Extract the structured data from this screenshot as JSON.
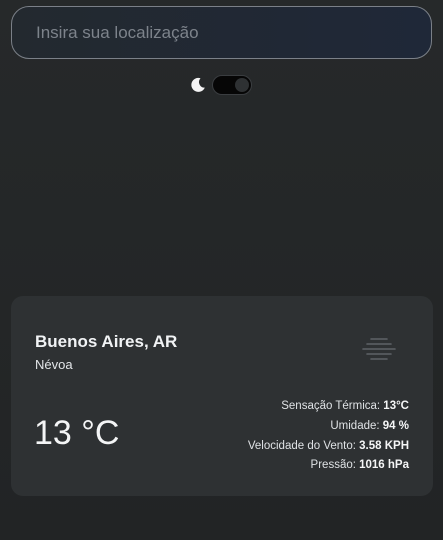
{
  "search": {
    "placeholder": "Insira sua localização",
    "value": ""
  },
  "theme": {
    "icon": "moon-icon",
    "toggle_state": "dark"
  },
  "weather": {
    "city": "Buenos Aires, AR",
    "condition": "Névoa",
    "icon": "fog-icon",
    "temperature": "13 °C",
    "feels_like_label": "Sensação Térmica:",
    "feels_like_value": "13°C",
    "humidity_label": "Umidade:",
    "humidity_value": "94 %",
    "wind_label": "Velocidade do Vento:",
    "wind_value": "3.58 KPH",
    "pressure_label": "Pressão:",
    "pressure_value": "1016 hPa"
  },
  "colors": {
    "background": "#242627",
    "card": "#2e3133",
    "search_border": "#7b8088",
    "toggle_track": "#060606"
  }
}
